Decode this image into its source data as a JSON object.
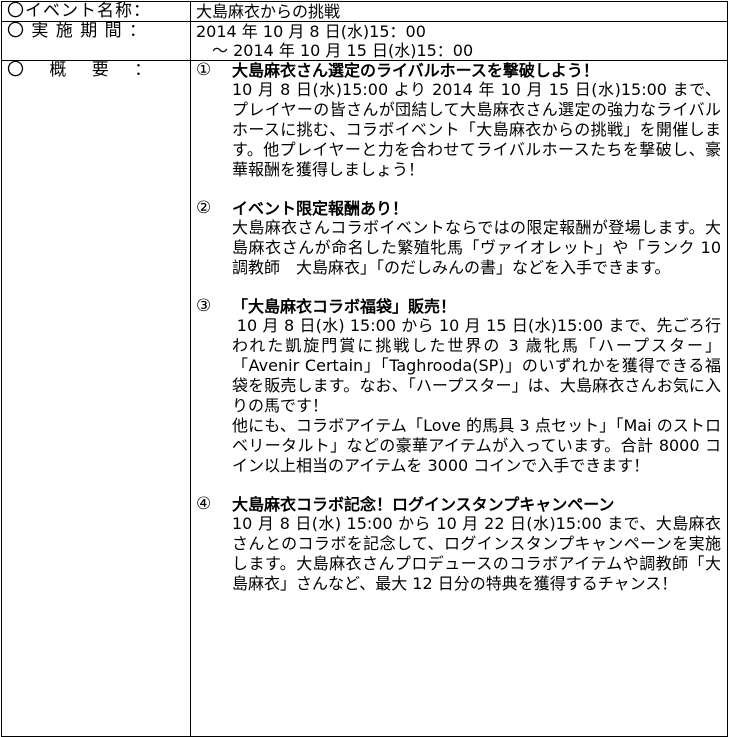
{
  "rows": {
    "event_name": {
      "label": "〇イベント名称：",
      "value": "大島麻衣からの挑戦"
    },
    "period": {
      "label": "〇 実 施 期 間 ：",
      "line1": "2014 年 10 月 8 日(水)15：00",
      "line2": "　～ 2014 年 10 月 15 日(水)15：00"
    },
    "overview": {
      "label": "〇　 概　 要 　：",
      "sections": [
        {
          "number": "①",
          "title": "大島麻衣さん選定のライバルホースを撃破しよう！",
          "paragraphs": [
            "10 月 8 日(水)15:00 より 2014 年 10 月 15 日(水)15:00 まで、プレイヤーの皆さんが団結して大島麻衣さん選定の強力なライバルホースに挑む、コラボイベント「大島麻衣からの挑戦」を開催します。他プレイヤーと力を合わせてライバルホースたちを撃破し、豪華報酬を獲得しましょう！"
          ]
        },
        {
          "number": "②",
          "title": "イベント限定報酬あり！",
          "paragraphs": [
            "大島麻衣さんコラボイベントならではの限定報酬が登場します。大島麻衣さんが命名した繁殖牝馬「ヴァイオレット」や「ランク 10 調教師　大島麻衣」「のだしみんの書」などを入手できます。"
          ]
        },
        {
          "number": "③",
          "title": "「大島麻衣コラボ福袋」販売！",
          "paragraphs": [
            "10 月 8 日(水) 15:00 から 10 月 15 日(水)15:00 まで、先ごろ行われた凱旋門賞に挑戦した世界の 3 歳牝馬「ハープスター」「Avenir Certain」「Taghrooda(SP)」のいずれかを獲得できる福袋を販売します。なお、「ハープスター」は、大島麻衣さんお気に入りの馬です！",
            "他にも、コラボアイテム「Love 的馬具 3 点セット」「Mai のストロベリータルト」などの豪華アイテムが入っています。合計 8000 コイン以上相当のアイテムを 3000 コインで入手できます！"
          ]
        },
        {
          "number": "④",
          "title": "大島麻衣コラボ記念！ログインスタンプキャンペーン",
          "paragraphs": [
            "10 月 8 日(水) 15:00 から 10 月 22 日(水)15:00 まで、大島麻衣さんとのコラボを記念して、ログインスタンプキャンペーンを実施します。大島麻衣さんプロデュースのコラボアイテムや調教師「大島麻衣」さんなど、最大 12 日分の特典を獲得するチャンス！"
          ]
        }
      ]
    }
  }
}
